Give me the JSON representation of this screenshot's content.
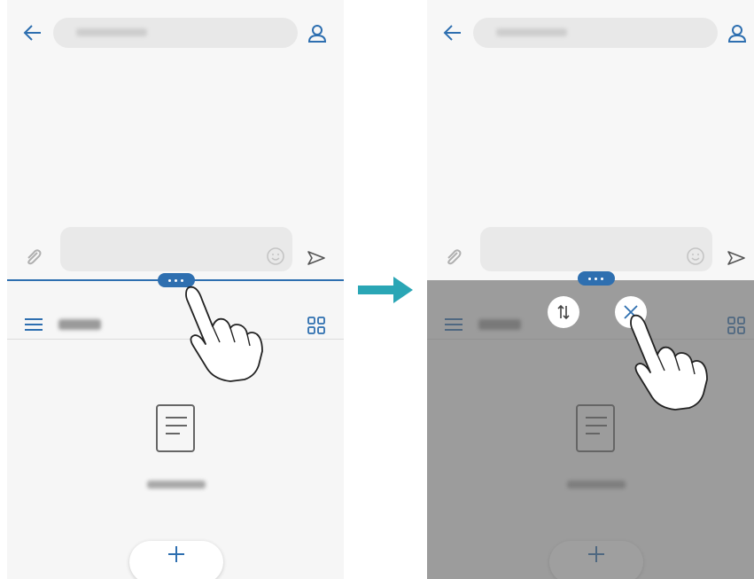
{
  "theme": {
    "accent": "#2e6fb0",
    "arrow": "#2aa6b5",
    "overlay": "#646464"
  },
  "left_panel": {
    "state": "split-screen with divider handle being tapped",
    "top_app": {
      "back_icon": "back-arrow-icon",
      "contact_icon": "contact-icon",
      "attach_icon": "paperclip-icon",
      "emoji_icon": "emoji-icon",
      "send_icon": "send-icon"
    },
    "bottom_app": {
      "menu_icon": "hamburger-menu-icon",
      "grid_icon": "grid-view-icon",
      "empty_icon": "document-icon",
      "add_icon": "plus-icon"
    },
    "gesture": "tap-hand-icon"
  },
  "right_panel": {
    "state": "divider options shown, bottom app dimmed",
    "swap_icon": "swap-updown-icon",
    "close_icon": "close-icon",
    "gesture": "tap-hand-icon"
  },
  "transition_icon": "right-arrow-icon"
}
